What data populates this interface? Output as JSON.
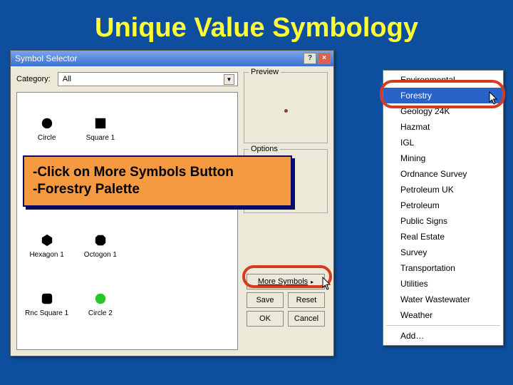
{
  "slide": {
    "title": "Unique Value Symbology"
  },
  "dialog": {
    "title": "Symbol Selector",
    "help": "?",
    "close": "×",
    "category_label": "Category:",
    "category_value": "All",
    "preview_legend": "Preview",
    "options_legend": "Options",
    "more_symbols_label": "More Symbols",
    "save_label": "Save",
    "reset_label": "Reset",
    "ok_label": "OK",
    "cancel_label": "Cancel",
    "symbols": [
      {
        "label": "Circle",
        "shape": "circle",
        "fill": "#000"
      },
      {
        "label": "Square 1",
        "shape": "square",
        "fill": "#000"
      },
      {
        "label": "",
        "shape": "",
        "fill": ""
      },
      {
        "label": "",
        "shape": "",
        "fill": ""
      },
      {
        "label": "",
        "shape": "",
        "fill": ""
      },
      {
        "label": "",
        "shape": "",
        "fill": ""
      },
      {
        "label": "",
        "shape": "",
        "fill": ""
      },
      {
        "label": "",
        "shape": "",
        "fill": ""
      },
      {
        "label": "Hexagon 1",
        "shape": "hexagon",
        "fill": "#000"
      },
      {
        "label": "Octogon 1",
        "shape": "octagon",
        "fill": "#000"
      },
      {
        "label": "",
        "shape": "",
        "fill": ""
      },
      {
        "label": "",
        "shape": "",
        "fill": ""
      },
      {
        "label": "Rnc Square 1",
        "shape": "rsquare",
        "fill": "#000"
      },
      {
        "label": "Circle 2",
        "shape": "circle",
        "fill": "#28c528"
      }
    ]
  },
  "callout": {
    "line1": "-Click on More Symbols Button",
    "line2": "-Forestry Palette"
  },
  "palette": {
    "items": [
      {
        "label": "Environmental",
        "checked": false,
        "selected": false
      },
      {
        "label": "Forestry",
        "checked": false,
        "selected": true
      },
      {
        "label": "Geology 24K",
        "checked": false,
        "selected": false
      },
      {
        "label": "Hazmat",
        "checked": false,
        "selected": false
      },
      {
        "label": "IGL",
        "checked": false,
        "selected": false
      },
      {
        "label": "Mining",
        "checked": false,
        "selected": false
      },
      {
        "label": "Ordnance Survey",
        "checked": false,
        "selected": false
      },
      {
        "label": "Petroleum UK",
        "checked": false,
        "selected": false
      },
      {
        "label": "Petroleum",
        "checked": false,
        "selected": false
      },
      {
        "label": "Public Signs",
        "checked": false,
        "selected": false
      },
      {
        "label": "Real Estate",
        "checked": false,
        "selected": false
      },
      {
        "label": "Survey",
        "checked": false,
        "selected": false
      },
      {
        "label": "Transportation",
        "checked": false,
        "selected": false
      },
      {
        "label": "Utilities",
        "checked": false,
        "selected": false
      },
      {
        "label": "Water Wastewater",
        "checked": false,
        "selected": false
      },
      {
        "label": "Weather",
        "checked": false,
        "selected": false
      }
    ],
    "add_label": "Add…"
  }
}
